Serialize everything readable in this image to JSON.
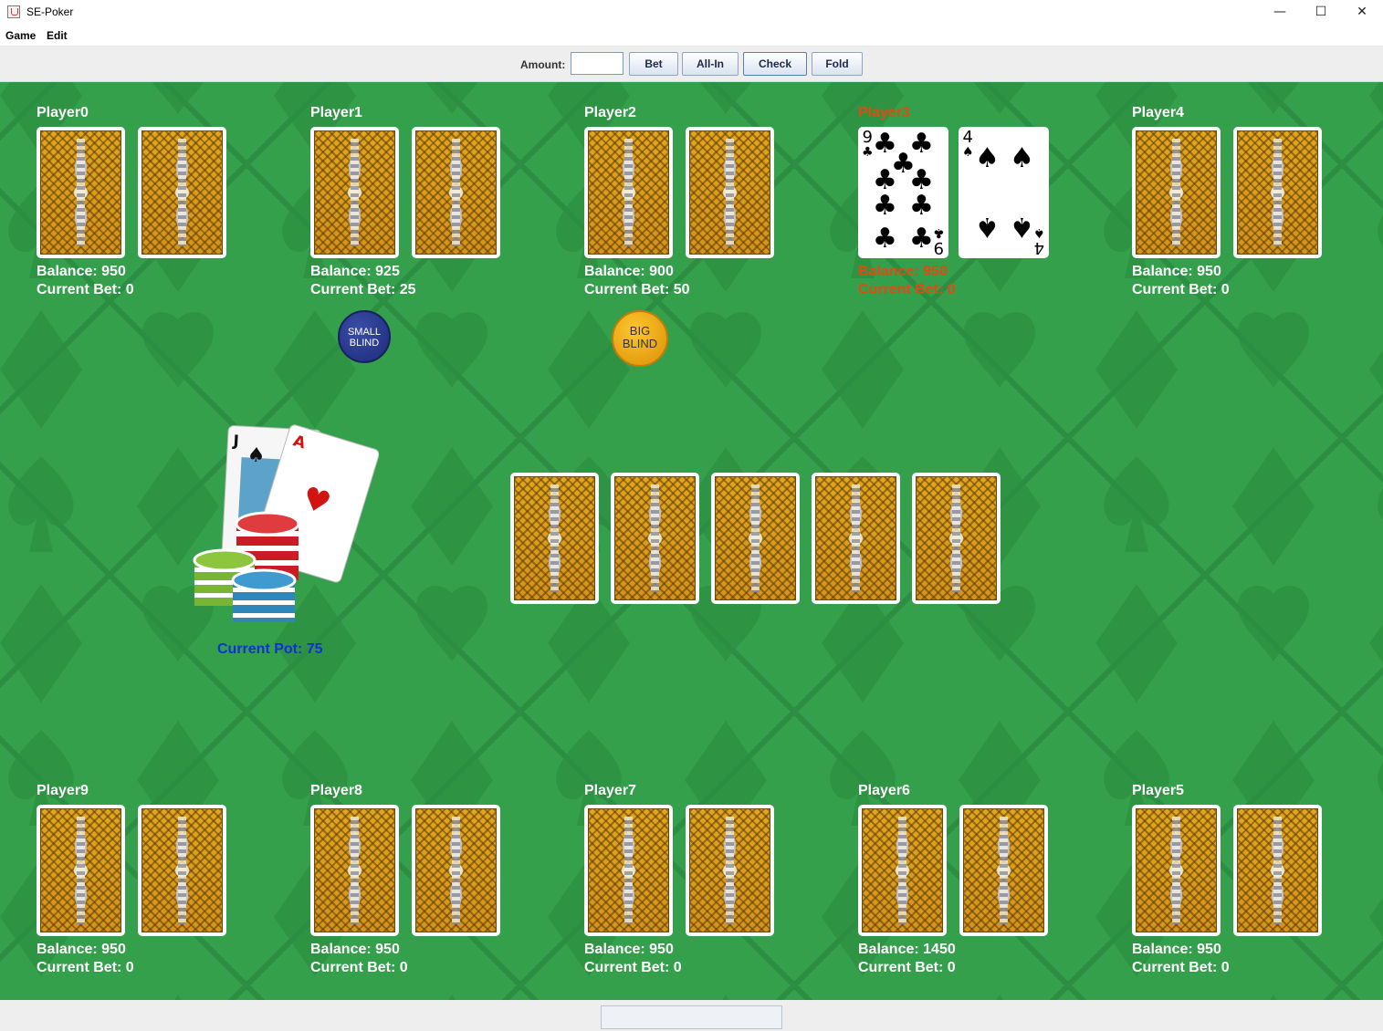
{
  "window": {
    "title": "SE-Poker",
    "controls": {
      "minimize": "—",
      "maximize": "☐",
      "close": "✕"
    }
  },
  "menu": [
    "Game",
    "Edit"
  ],
  "toolbar": {
    "amount_label": "Amount:",
    "amount_value": "",
    "buttons": [
      "Bet",
      "All-In",
      "Check",
      "Fold"
    ]
  },
  "players": [
    {
      "name": "Player0",
      "balance": "Balance: 950",
      "bet": "Current Bet: 0"
    },
    {
      "name": "Player1",
      "balance": "Balance: 925",
      "bet": "Current Bet: 25"
    },
    {
      "name": "Player2",
      "balance": "Balance: 900",
      "bet": "Current Bet: 50"
    },
    {
      "name": "Player3",
      "balance": "Balance: 950",
      "bet": "Current Bet: 0"
    },
    {
      "name": "Player4",
      "balance": "Balance: 950",
      "bet": "Current Bet: 0"
    },
    {
      "name": "Player9",
      "balance": "Balance: 950",
      "bet": "Current Bet: 0"
    },
    {
      "name": "Player8",
      "balance": "Balance: 950",
      "bet": "Current Bet: 0"
    },
    {
      "name": "Player7",
      "balance": "Balance: 950",
      "bet": "Current Bet: 0"
    },
    {
      "name": "Player6",
      "balance": "Balance: 1450",
      "bet": "Current Bet: 0"
    },
    {
      "name": "Player5",
      "balance": "Balance: 950",
      "bet": "Current Bet: 0"
    }
  ],
  "active_player_color": "#e24a12",
  "player3_cards": [
    {
      "rank": "9",
      "suit": "♣"
    },
    {
      "rank": "4",
      "suit": "♠"
    }
  ],
  "chips": {
    "small_blind": [
      "SMALL",
      "BLIND"
    ],
    "big_blind": [
      "BIG",
      "BLIND"
    ]
  },
  "pot": {
    "label": "Current Pot: 75",
    "color": "#1131d6"
  },
  "logo_cards": {
    "jack": "J",
    "ace": "A",
    "jack_suit": "♠",
    "ace_suit": "♥"
  },
  "table_color": "#35a04c"
}
